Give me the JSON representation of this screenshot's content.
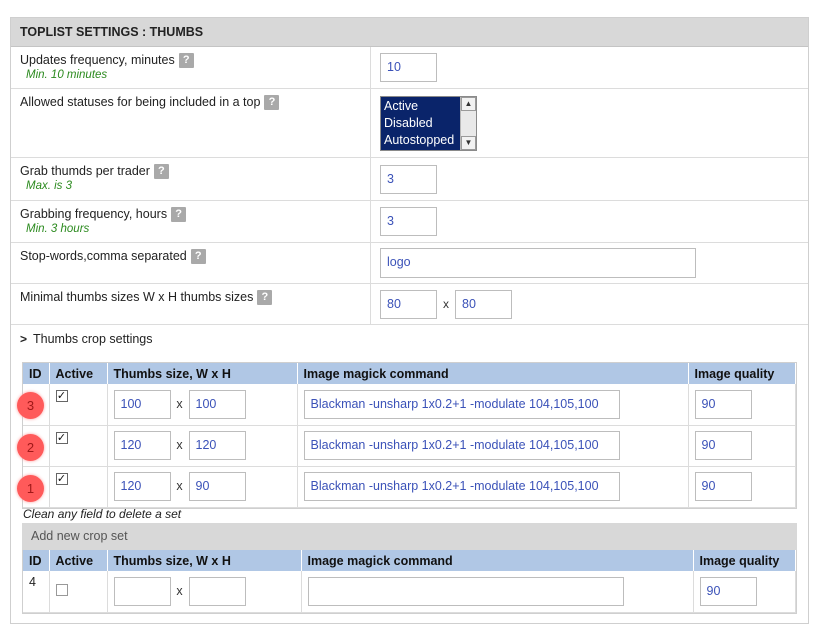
{
  "panel": {
    "title": "TOPLIST SETTINGS : THUMBS"
  },
  "help_icon": "?",
  "settings": [
    {
      "label": "Updates frequency, minutes",
      "hint": "Min. 10 minutes",
      "value": "10"
    },
    {
      "label": "Allowed statuses for being included in a top",
      "hint": "",
      "options": [
        "Active",
        "Disabled",
        "Autostopped"
      ]
    },
    {
      "label": "Grab thumds per trader",
      "hint": "Max. is 3",
      "value": "3"
    },
    {
      "label": "Grabbing frequency, hours",
      "hint": "Min. 3 hours",
      "value": "3"
    },
    {
      "label": "Stop-words,comma separated",
      "hint": "",
      "value": "logo"
    },
    {
      "label": "Minimal thumbs sizes W x H thumbs sizes",
      "hint": "",
      "width": "80",
      "height": "80"
    }
  ],
  "x_sep": "x",
  "crop": {
    "title": "Thumbs crop settings",
    "columns": [
      "ID",
      "Active",
      "Thumbs size, W x H",
      "Image magick command",
      "Image quality"
    ],
    "rows": [
      {
        "id": "3",
        "active": true,
        "w": "100",
        "h": "100",
        "command": "Blackman -unsharp 1x0.2+1 -modulate 104,105,100",
        "quality": "90"
      },
      {
        "id": "2",
        "active": true,
        "w": "120",
        "h": "120",
        "command": "Blackman -unsharp 1x0.2+1 -modulate 104,105,100",
        "quality": "90"
      },
      {
        "id": "1",
        "active": true,
        "w": "120",
        "h": "90",
        "command": "Blackman -unsharp 1x0.2+1 -modulate 104,105,100",
        "quality": "90"
      }
    ],
    "clean_note": "Clean any field to delete a set",
    "add_title": "Add new crop set",
    "new_row": {
      "id": "4",
      "active": false,
      "w": "",
      "h": "",
      "command": "",
      "quality": "90"
    }
  },
  "colors": {
    "header_bg": "#d8d8d8",
    "table_header_bg": "#b0c7e5",
    "hint": "#2b8a1e",
    "input_text": "#3b52b8",
    "badge": "#ff5a5a"
  }
}
